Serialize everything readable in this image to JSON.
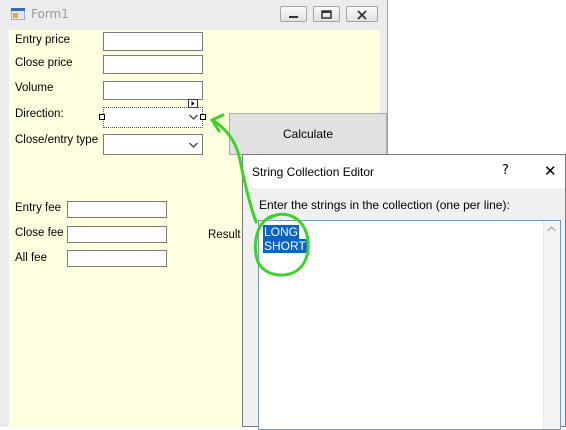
{
  "form1": {
    "title": "Form1",
    "labels": {
      "entry_price": "Entry price",
      "close_price": "Close price",
      "volume": "Volume",
      "direction": "Direction:",
      "close_entry_type": "Close/entry type",
      "entry_fee": "Entry fee",
      "close_fee": "Close fee",
      "all_fee": "All fee",
      "result": "Result"
    },
    "calculate_label": "Calculate"
  },
  "editor": {
    "title": "String Collection Editor",
    "help_glyph": "?",
    "close_glyph": "✕",
    "prompt": "Enter the strings in the collection (one per line):",
    "lines": [
      "LONG",
      "SHORT"
    ]
  },
  "colors": {
    "form_client": "#ffffe0",
    "selection": "#0a64c8",
    "annotation": "#3cd22a"
  }
}
